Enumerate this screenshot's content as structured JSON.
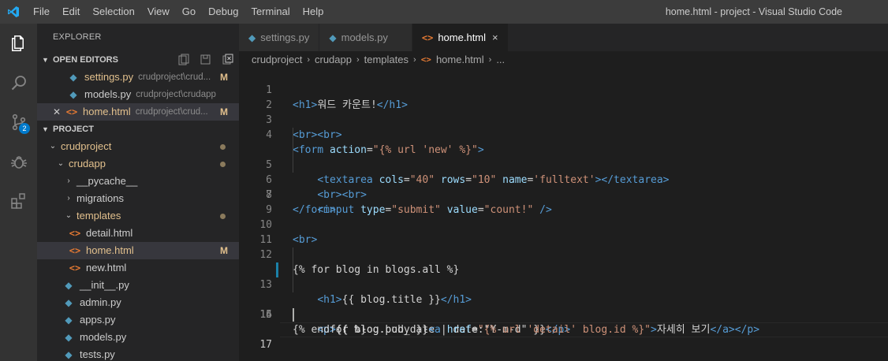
{
  "titlebar": {
    "logo": "vscode-logo",
    "menu": [
      "File",
      "Edit",
      "Selection",
      "View",
      "Go",
      "Debug",
      "Terminal",
      "Help"
    ],
    "window_title": "home.html - project - Visual Studio Code"
  },
  "activitybar": {
    "items": [
      "explorer-icon",
      "search-icon",
      "source-control-icon",
      "debug-icon",
      "extensions-icon"
    ],
    "scm_badge": "2"
  },
  "sidebar": {
    "title": "EXPLORER",
    "open_editors": {
      "header": "OPEN EDITORS",
      "items": [
        {
          "name": "settings.py",
          "desc": "crudproject\\crud...",
          "flag": "M"
        },
        {
          "name": "models.py",
          "desc": "crudproject\\crudapp",
          "flag": ""
        },
        {
          "name": "home.html",
          "desc": "crudproject\\crud...",
          "flag": "M"
        }
      ]
    },
    "project": {
      "header": "PROJECT",
      "items": [
        {
          "name": "crudproject"
        },
        {
          "name": "crudapp"
        },
        {
          "name": "__pycache__"
        },
        {
          "name": "migrations"
        },
        {
          "name": "templates"
        },
        {
          "name": "detail.html"
        },
        {
          "name": "home.html",
          "flag": "M"
        },
        {
          "name": "new.html"
        },
        {
          "name": "__init__.py"
        },
        {
          "name": "admin.py"
        },
        {
          "name": "apps.py"
        },
        {
          "name": "models.py"
        },
        {
          "name": "tests.py"
        }
      ]
    }
  },
  "editor": {
    "tabs": [
      {
        "label": "settings.py"
      },
      {
        "label": "models.py"
      },
      {
        "label": "home.html",
        "close": "×"
      }
    ],
    "breadcrumbs": [
      "crudproject",
      "crudapp",
      "templates",
      "home.html",
      "..."
    ],
    "line_numbers": [
      "1",
      "2",
      "3",
      "4",
      "5",
      "6",
      "7",
      "8",
      "9",
      "10",
      "11",
      "12",
      "13",
      "14",
      "15",
      "16",
      "17"
    ],
    "code": {
      "l1_open": "<h1>",
      "l1_text": "워드 카운트!",
      "l1_close": "</h1>",
      "l3": "<br><br>",
      "l4_tag": "<form",
      "l4_attr": "action",
      "l4_val": "\"{% url 'new' %}\"",
      "l4_end": ">",
      "l5_tag": "<textarea",
      "l5_a1": "cols",
      "l5_v1": "\"40\"",
      "l5_a2": "rows",
      "l5_v2": "\"10\"",
      "l5_a3": "name",
      "l5_v3": "'fulltext'",
      "l5_end": "></textarea>",
      "l6": "<br><br>",
      "l7_tag": "<input",
      "l7_a1": "type",
      "l7_v1": "\"submit\"",
      "l7_a2": "value",
      "l7_v2": "\"count!\"",
      "l7_end": "/>",
      "l8": "</form>",
      "l10": "<br>",
      "l12": "{% for blog in blogs.all %}",
      "l13_open": "<h1>",
      "l13_text": "{{ blog.title }}",
      "l13_close": "</h1>",
      "l14_open": "<p>",
      "l14_text": "{{ blog.pub_date | date:\"Y-m-d\" }}",
      "l14_close": "</p>",
      "l15_open": "<p>",
      "l15_text": "{{ blog.body }}",
      "l15_a": "<a",
      "l15_attr": "href",
      "l15_val": "\"{% url 'detail' blog.id %}\"",
      "l15_gt": ">",
      "l15_link": "자세히 보기",
      "l15_close": "</a></p>",
      "l16": "{% endfor %}"
    }
  }
}
